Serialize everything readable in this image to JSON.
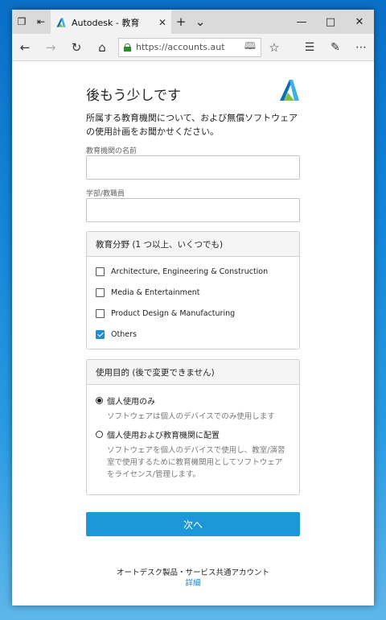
{
  "browser": {
    "tab_title": "Autodesk - 教育",
    "url": "https://accounts.aut"
  },
  "colors": {
    "accent": "#1c98d8",
    "checkbox_checked": "#1a8fd8",
    "link": "#1c7fd0"
  },
  "page": {
    "heading": "後もう少しです",
    "intro": "所属する教育機関について、および無償ソフトウェアの使用計画をお聞かせください。",
    "institution_label": "教育機関の名前",
    "institution_value": "",
    "department_label": "学部/教職員",
    "department_value": "",
    "field_panel": {
      "title": "教育分野 (1 つ以上、いくつでも)",
      "options": [
        {
          "label": "Architecture, Engineering & Construction",
          "checked": false
        },
        {
          "label": "Media & Entertainment",
          "checked": false
        },
        {
          "label": "Product Design & Manufacturing",
          "checked": false
        },
        {
          "label": "Others",
          "checked": true
        }
      ]
    },
    "usage_panel": {
      "title": "使用目的 (後で変更できません)",
      "options": [
        {
          "label": "個人使用のみ",
          "description": "ソフトウェアは個人のデバイスでのみ使用します",
          "selected": true
        },
        {
          "label": "個人使用および教育機関に配置",
          "description": "ソフトウェアを個人のデバイスで使用し、教室/演習室で使用するために教育機関用としてソフトウェアをライセンス/管理します。",
          "selected": false
        }
      ]
    },
    "next_button": "次へ",
    "footer_text": "オートデスク製品・サービス共通アカウント",
    "footer_link": "詳細"
  }
}
